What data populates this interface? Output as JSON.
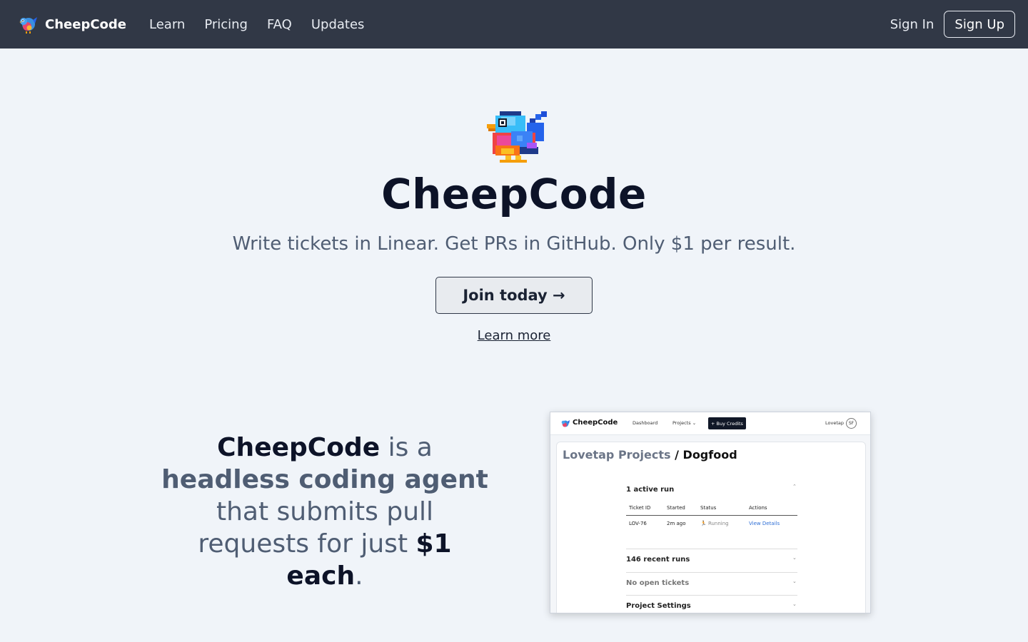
{
  "nav": {
    "brand": "CheepCode",
    "links": [
      "Learn",
      "Pricing",
      "FAQ",
      "Updates"
    ],
    "sign_in": "Sign In",
    "sign_up": "Sign Up"
  },
  "hero": {
    "title": "CheepCode",
    "subtitle": "Write tickets in Linear. Get PRs in GitHub. Only $1 per result.",
    "cta": "Join today →",
    "learn_more": "Learn more"
  },
  "tagline": {
    "brand": "CheepCode",
    "t1": " is a ",
    "bold1": "headless coding agent",
    "t2": " that submits pull requests for just ",
    "bold2": "$1 each",
    "t3": "."
  },
  "screenshot": {
    "brand": "CheepCode",
    "nav_dashboard": "Dashboard",
    "nav_projects": "Projects ⌄",
    "buy_credits": "+ Buy Credits",
    "user": "Lovetap",
    "avatar": "SF",
    "crumb_parent": "Lovetap Projects",
    "crumb_sep": " / ",
    "crumb_current": "Dogfood",
    "active_runs": "1 active run",
    "columns": [
      "Ticket ID",
      "Started",
      "Status",
      "Actions"
    ],
    "row": {
      "ticket": "LOV-76",
      "started": "2m ago",
      "status": "🏃 Running",
      "action": "View Details"
    },
    "recent_runs": "146 recent runs",
    "open_tickets": "No open tickets",
    "settings": "Project Settings"
  }
}
